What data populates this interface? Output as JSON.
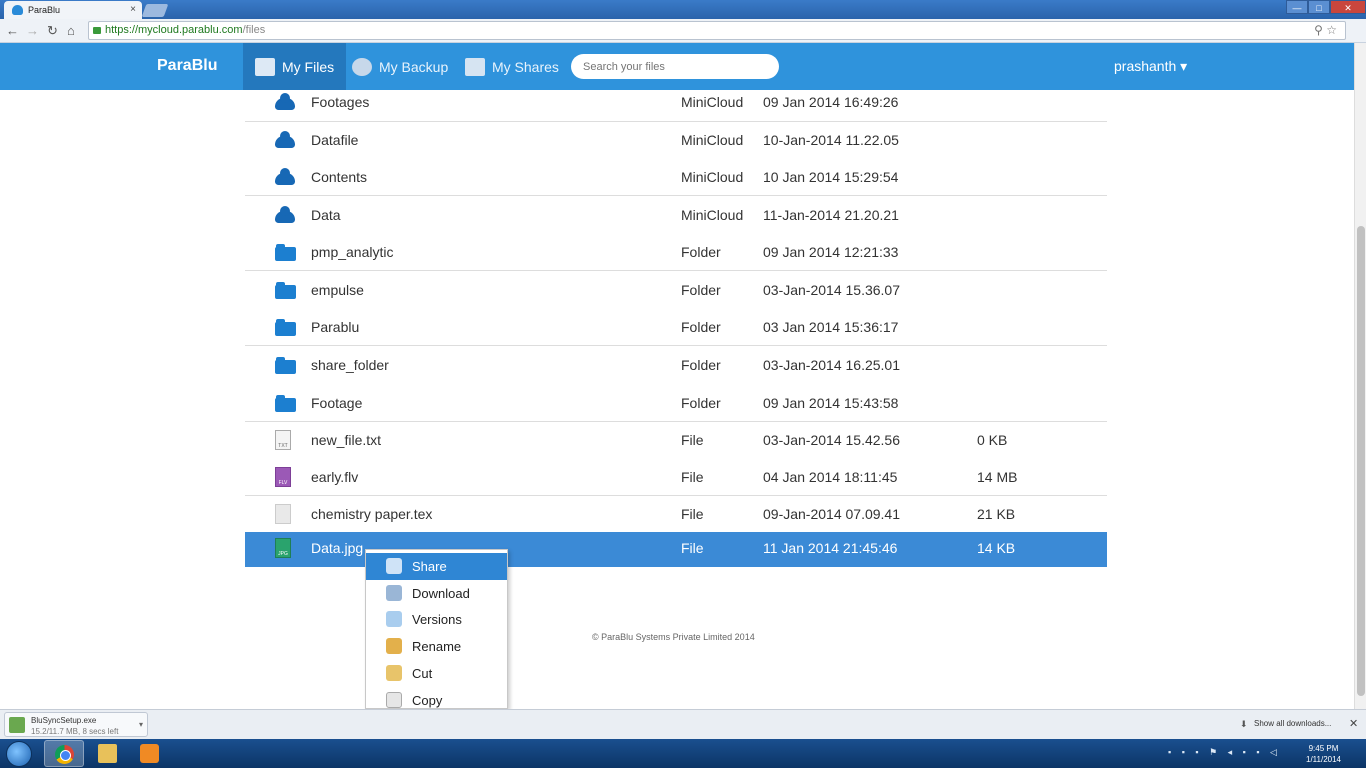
{
  "browser": {
    "tab_title": "ParaBlu",
    "tab_close": "×",
    "url_host": "https://mycloud.parablu.com",
    "url_path": "/files",
    "window_buttons": [
      "—",
      "□",
      "✕"
    ]
  },
  "app": {
    "brand": "ParaBlu",
    "nav": [
      {
        "label": "My Files",
        "icon": "files-icon",
        "active": true
      },
      {
        "label": "My Backup",
        "icon": "backup-icon",
        "active": false
      },
      {
        "label": "My Shares",
        "icon": "shares-icon",
        "active": false
      }
    ],
    "search_placeholder": "Search your files",
    "user": "prashanth ▾"
  },
  "files": [
    {
      "name": "Footages",
      "type": "MiniCloud",
      "date": "09 Jan 2014 16:49:26",
      "size": "",
      "icon": "cloud"
    },
    {
      "name": "Datafile",
      "type": "MiniCloud",
      "date": "10-Jan-2014 11.22.05",
      "size": "",
      "icon": "cloud"
    },
    {
      "name": "Contents",
      "type": "MiniCloud",
      "date": "10 Jan 2014 15:29:54",
      "size": "",
      "icon": "cloud"
    },
    {
      "name": "Data",
      "type": "MiniCloud",
      "date": "11-Jan-2014 21.20.21",
      "size": "",
      "icon": "cloud"
    },
    {
      "name": "pmp_analytic",
      "type": "Folder",
      "date": "09 Jan 2014 12:21:33",
      "size": "",
      "icon": "folder"
    },
    {
      "name": "empulse",
      "type": "Folder",
      "date": "03-Jan-2014 15.36.07",
      "size": "",
      "icon": "folder"
    },
    {
      "name": "Parablu",
      "type": "Folder",
      "date": "03 Jan 2014 15:36:17",
      "size": "",
      "icon": "folder"
    },
    {
      "name": "share_folder",
      "type": "Folder",
      "date": "03-Jan-2014 16.25.01",
      "size": "",
      "icon": "folder"
    },
    {
      "name": "Footage",
      "type": "Folder",
      "date": "09 Jan 2014 15:43:58",
      "size": "",
      "icon": "folder"
    },
    {
      "name": "new_file.txt",
      "type": "File",
      "date": "03-Jan-2014 15.42.56",
      "size": "0 KB",
      "icon": "txt"
    },
    {
      "name": "early.flv",
      "type": "File",
      "date": "04 Jan 2014 18:11:45",
      "size": "14 MB",
      "icon": "flv"
    },
    {
      "name": "chemistry paper.tex",
      "type": "File",
      "date": "09-Jan-2014 07.09.41",
      "size": "21 KB",
      "icon": "tex"
    },
    {
      "name": "Data.jpg",
      "type": "File",
      "date": "11 Jan 2014 21:45:46",
      "size": "14 KB",
      "icon": "jpg",
      "selected": true
    }
  ],
  "context_menu": [
    {
      "label": "Share",
      "icon": "share-icon",
      "highlighted": true
    },
    {
      "label": "Download",
      "icon": "download-icon"
    },
    {
      "label": "Versions",
      "icon": "versions-icon"
    },
    {
      "label": "Rename",
      "icon": "rename-icon"
    },
    {
      "label": "Cut",
      "icon": "cut-icon"
    },
    {
      "label": "Copy",
      "icon": "copy-icon"
    }
  ],
  "footer": "© ParaBlu Systems Private Limited 2014",
  "downloads": {
    "filename": "BluSyncSetup.exe",
    "status": "15.2/11.7 MB, 8 secs left",
    "show_all": "Show all downloads..."
  },
  "taskbar": {
    "time": "9:45 PM",
    "date": "1/11/2014"
  },
  "colors": {
    "navbar": "#2f93dc",
    "nav_active": "#2478bd",
    "selected_row": "#3b8ad6",
    "menu_highlight": "#2f86d4"
  }
}
